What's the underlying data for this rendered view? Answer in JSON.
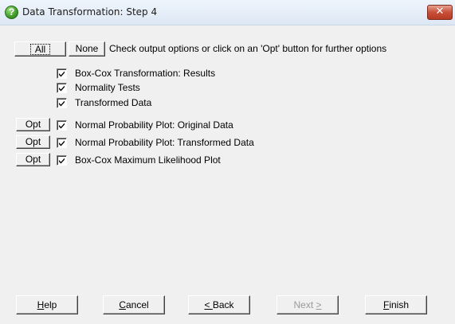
{
  "window": {
    "title": "Data Transformation: Step 4",
    "title_icon": "question-icon",
    "close_label": "✕"
  },
  "header": {
    "all_label": "All",
    "none_label": "None",
    "hint": "Check output options or click on an 'Opt' button for further options"
  },
  "options": [
    {
      "label": "Box-Cox Transformation: Results",
      "checked": true,
      "has_opt": false
    },
    {
      "label": "Normality Tests",
      "checked": true,
      "has_opt": false
    },
    {
      "label": "Transformed Data",
      "checked": true,
      "has_opt": false
    },
    {
      "label": "Normal Probability Plot: Original Data",
      "checked": true,
      "has_opt": true,
      "opt_label": "Opt"
    },
    {
      "label": "Normal Probability Plot: Transformed Data",
      "checked": true,
      "has_opt": true,
      "opt_label": "Opt"
    },
    {
      "label": "Box-Cox Maximum Likelihood Plot",
      "checked": true,
      "has_opt": true,
      "opt_label": "Opt"
    }
  ],
  "footer": {
    "help": {
      "mnemonic": "H",
      "rest": "elp"
    },
    "cancel": {
      "mnemonic": "C",
      "rest": "ancel"
    },
    "back": {
      "mnemonic": "< ",
      "rest": "Back"
    },
    "next": {
      "pre": "Next ",
      "mnemonic": ">",
      "enabled": false
    },
    "finish": {
      "mnemonic": "F",
      "rest": "inish"
    }
  }
}
